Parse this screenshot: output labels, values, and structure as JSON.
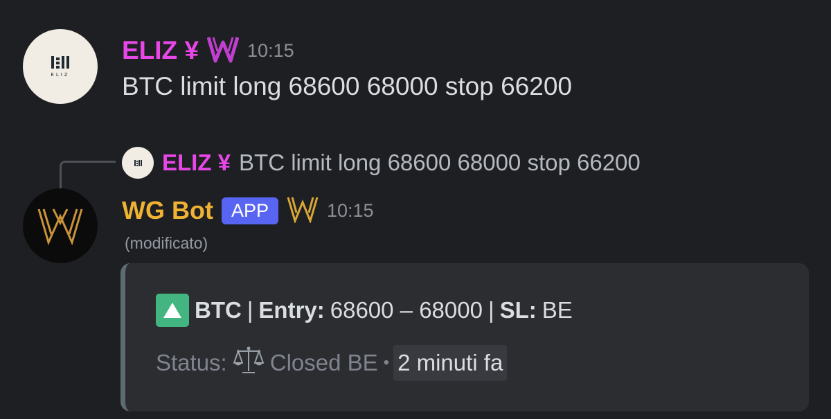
{
  "messages": [
    {
      "author": "ELIZ ¥",
      "author_color": "#e847e8",
      "time": "10:15",
      "text": "BTC limit long 68600 68000 stop 66200",
      "avatar_text": "ELIZ",
      "role_icon": "w-role-icon"
    },
    {
      "author": "WG Bot",
      "author_color": "#f0b232",
      "badge": "APP",
      "time": "10:15",
      "edited_label": "(modificato)",
      "role_icon": "w-role-icon",
      "reply": {
        "author": "ELIZ ¥",
        "text": "BTC limit long 68600 68000 stop 66200"
      },
      "embed": {
        "accent_color": "#5d6b74",
        "icon": "up-arrow-icon",
        "asset": "BTC",
        "separator": "|",
        "entry_label": "Entry:",
        "entry_value": "68600 – 68000",
        "sl_label": "SL:",
        "sl_value": "BE",
        "status_label": "Status:",
        "status_icon": "balance-scale-icon",
        "status_value": "Closed BE",
        "bullet": "•",
        "relative_time": "2 minuti fa"
      }
    }
  ]
}
